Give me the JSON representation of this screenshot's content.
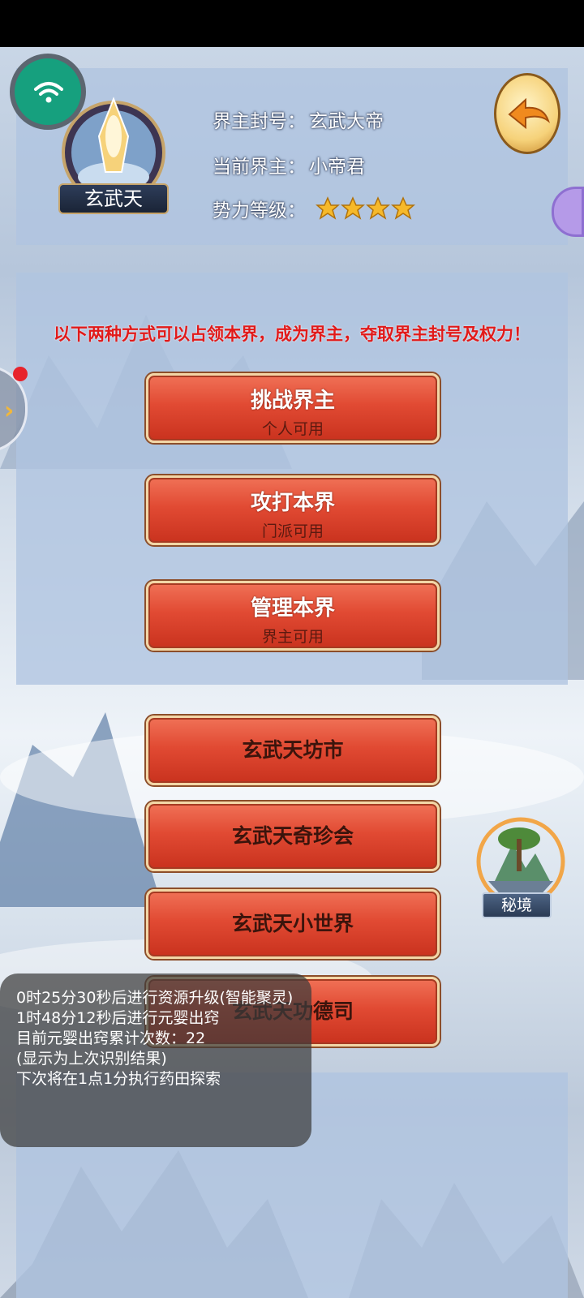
{
  "realm": {
    "name": "玄武天",
    "title_label": "界主封号：",
    "title_value": "玄武大帝",
    "lord_label": "当前界主：",
    "lord_value": "小帝君",
    "level_label": "势力等级：",
    "level_stars": 4
  },
  "notice": "以下两种方式可以占领本界，成为界主，夺取界主封号及权力！",
  "actions": [
    {
      "label": "挑战界主",
      "sub": "个人可用"
    },
    {
      "label": "攻打本界",
      "sub": "门派可用"
    },
    {
      "label": "管理本界",
      "sub": "界主可用"
    }
  ],
  "menu": [
    {
      "label": "玄武天坊市"
    },
    {
      "label": "玄武天奇珍会"
    },
    {
      "label": "玄武天小世界"
    },
    {
      "label": "玄武天功德司"
    }
  ],
  "secret": {
    "label": "秘境"
  },
  "overlay": {
    "lines": [
      "0时25分30秒后进行资源升级(智能聚灵)",
      "1时48分12秒后进行元婴出窍",
      "目前元婴出窍累计次数：22",
      "(显示为上次识别结果)",
      "下次将在1点1分执行药田探索"
    ]
  },
  "colors": {
    "button_red": "#e14a33",
    "notice_red": "#e11a1a",
    "wifi_green": "#16a07e",
    "star_gold": "#f6b92a"
  },
  "icons": {
    "back": "back-arrow-icon",
    "wifi": "wifi-icon",
    "star": "star-icon",
    "expand": "chevron-right-icon"
  }
}
